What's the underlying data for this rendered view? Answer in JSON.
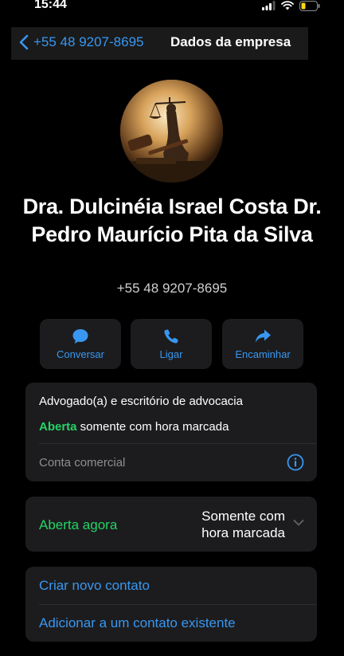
{
  "status_bar": {
    "time": "15:44"
  },
  "nav": {
    "back_label": "+55 48 9207-8695",
    "title": "Dados da empresa"
  },
  "profile": {
    "name": "Dra. Dulcinéia Israel Costa Dr. Pedro Maurício Pita da Silva",
    "phone": "+55 48 9207-8695",
    "avatar_icon": "scales-of-justice-gavel-image"
  },
  "actions": [
    {
      "label": "Conversar",
      "icon": "chat-bubble-icon"
    },
    {
      "label": "Ligar",
      "icon": "phone-icon"
    },
    {
      "label": "Encaminhar",
      "icon": "share-arrow-icon"
    }
  ],
  "business": {
    "category": "Advogado(a) e escritório de advocacia",
    "hours_status": "Aberta",
    "hours_rest": " somente com hora marcada",
    "account_type": "Conta comercial"
  },
  "hours": {
    "open_now": "Aberta agora",
    "detail_line1": "Somente com",
    "detail_line2": "hora marcada"
  },
  "contact_actions": {
    "create": "Criar novo contato",
    "add_existing": "Adicionar a um contato existente"
  },
  "colors": {
    "accent": "#3897f1",
    "open_green": "#25d366",
    "card_bg": "#1c1c1e",
    "battery_low": "#ffd60a"
  }
}
